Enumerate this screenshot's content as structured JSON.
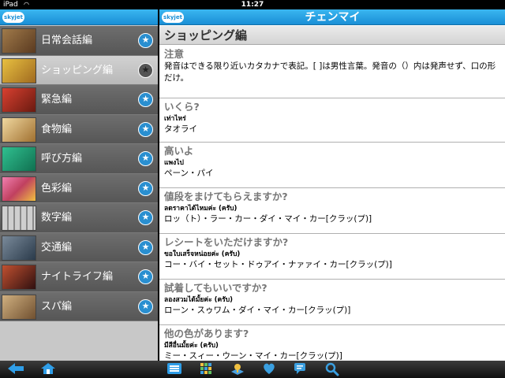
{
  "status": {
    "carrier": "iPad",
    "time": "11:27"
  },
  "app": {
    "logo_text": "skyjet"
  },
  "categories": [
    {
      "label": "日常会話編",
      "thumb_color": "#7a5a3a",
      "selected": false
    },
    {
      "label": "ショッピング編",
      "thumb_color": "#c9a23a",
      "selected": true
    },
    {
      "label": "緊急編",
      "thumb_color": "#b8302a",
      "selected": false
    },
    {
      "label": "食物編",
      "thumb_color": "#d0b070",
      "selected": false
    },
    {
      "label": "呼び方編",
      "thumb_color": "#2aa87a",
      "selected": false
    },
    {
      "label": "色彩編",
      "thumb_color": "#d05a8a",
      "selected": false
    },
    {
      "label": "数字編",
      "thumb_color": "#9a9a9a",
      "selected": false
    },
    {
      "label": "交通編",
      "thumb_color": "#4a5a6a",
      "selected": false
    },
    {
      "label": "ナイトライフ編",
      "thumb_color": "#8a3a2a",
      "selected": false
    },
    {
      "label": "スパ編",
      "thumb_color": "#b09060",
      "selected": false
    }
  ],
  "detail": {
    "city_title": "チェンマイ",
    "section_title": "ショッピング編",
    "note": {
      "heading": "注意",
      "body": "発音はできる限り近いカタカナで表記。[ ]は男性言葉。発音の（）内は発声せず、口の形だけ。"
    },
    "phrases": [
      {
        "jp": "いくら?",
        "th": "เท่าไหร่",
        "kana": "タオライ"
      },
      {
        "jp": "高いよ",
        "th": "แพงไป",
        "kana": "ペーン・パイ"
      },
      {
        "jp": "値段をまけてもらえますか?",
        "th": "ลดราคาได้ไหมค่ะ (ครับ)",
        "kana": "ロッ（ト）・ラー・カー・ダイ・マイ・カー[クラッ(プ)]"
      },
      {
        "jp": "レシートをいただけますか?",
        "th": "ขอใบเสร็จหน่อยค่ะ (ครับ)",
        "kana": "コー・バイ・セット・ドゥアイ・ナァァイ・カー[クラッ(プ)]"
      },
      {
        "jp": "試着してもいいですか?",
        "th": "ลองสวมได้มั้ยค่ะ (ครับ)",
        "kana": "ローン・スゥワム・ダイ・マイ・カー[クラッ(プ)]"
      },
      {
        "jp": "他の色があります?",
        "th": "มีสีอื่นมั้ยค่ะ (ครับ)",
        "kana": "ミー・スィー・ウーン・マイ・カー[クラッ(プ)]"
      }
    ]
  },
  "bottombar": {
    "icons": [
      "back-arrow-icon",
      "home-icon",
      "list-icon",
      "grid-icon",
      "map-icon",
      "heart-icon",
      "chat-icon",
      "search-icon"
    ]
  }
}
